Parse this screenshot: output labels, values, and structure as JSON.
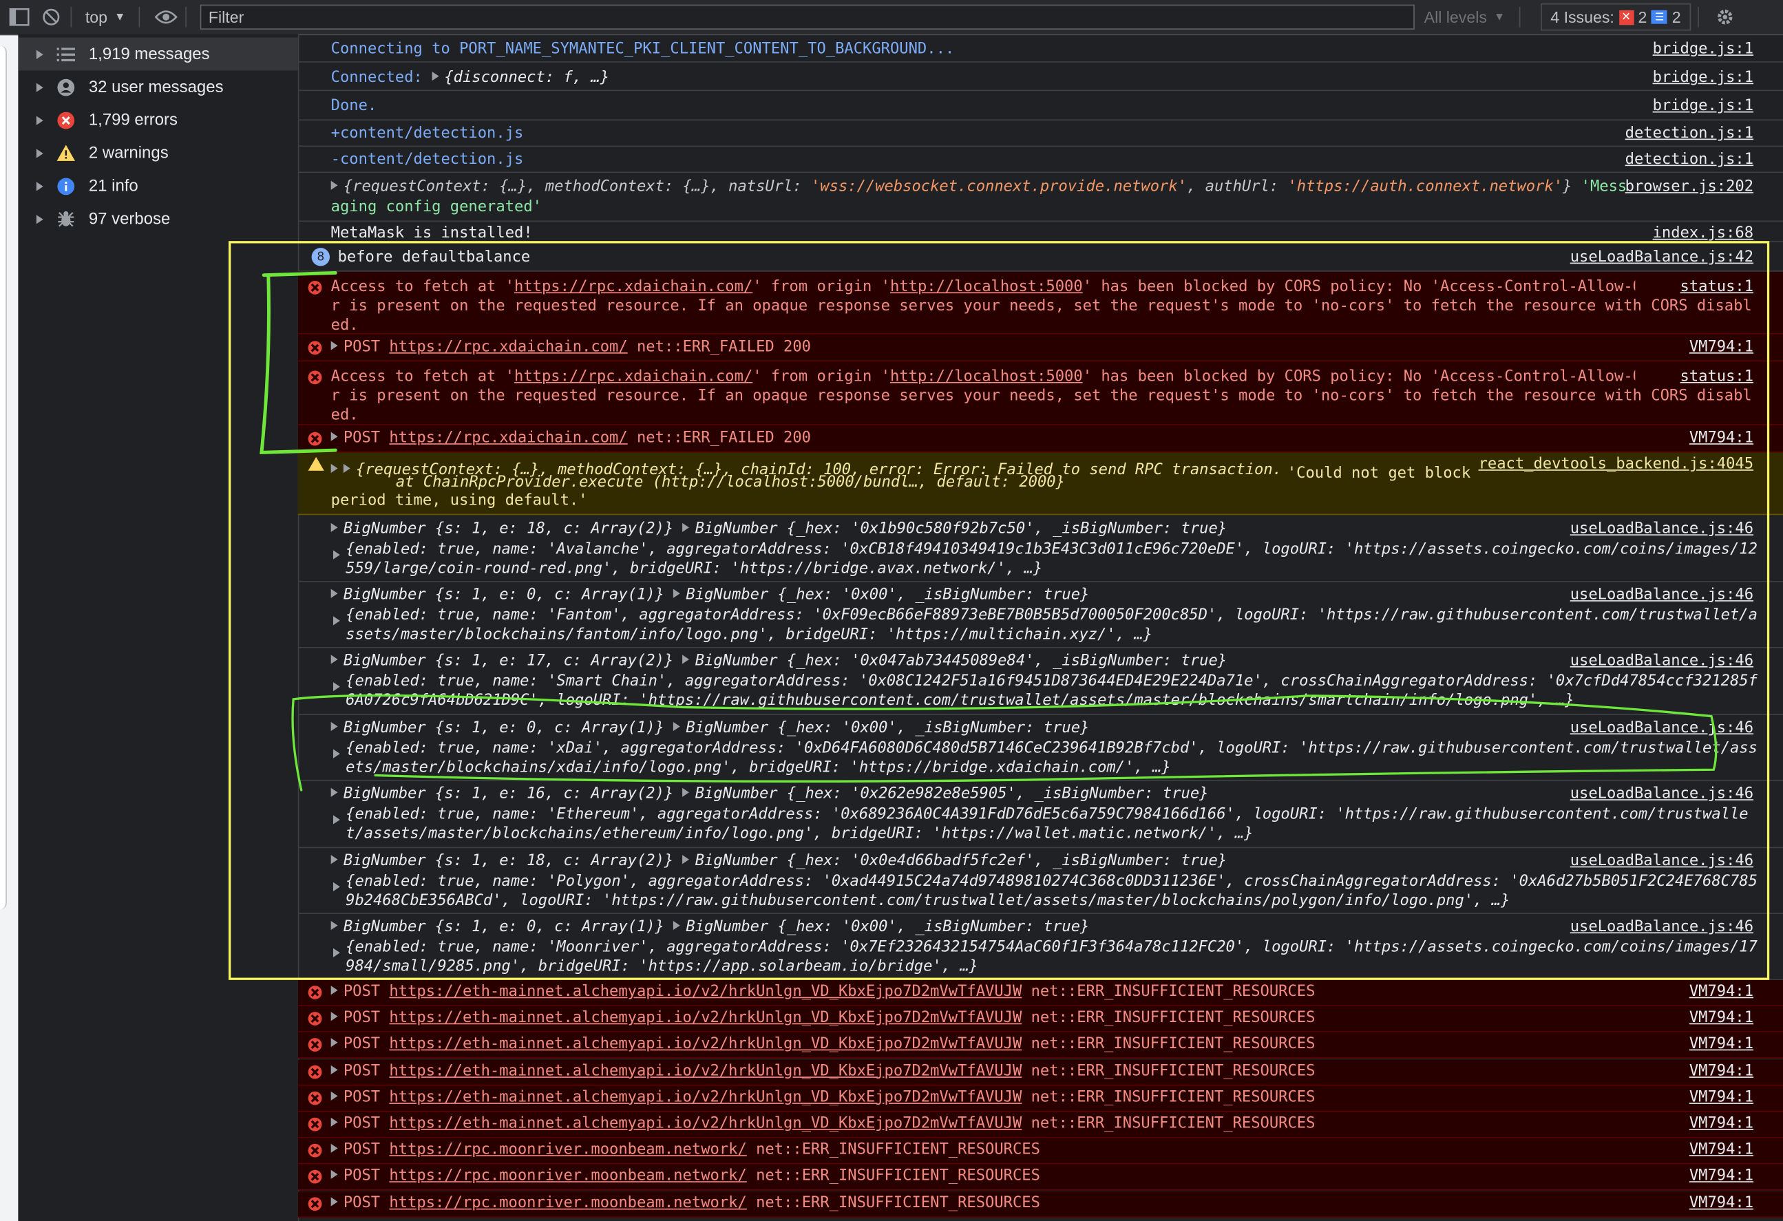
{
  "toolbar": {
    "context": "top",
    "filter_placeholder": "Filter",
    "levels": "All levels",
    "issues_label": "4 Issues:",
    "issues_errors": "2",
    "issues_info": "2"
  },
  "sidebar": {
    "items": [
      {
        "label": "1,919 messages",
        "icon": "list-icon"
      },
      {
        "label": "32 user messages",
        "icon": "user-icon"
      },
      {
        "label": "1,799 errors",
        "icon": "error-icon"
      },
      {
        "label": "2 warnings",
        "icon": "warning-icon"
      },
      {
        "label": "21 info",
        "icon": "info-icon"
      },
      {
        "label": "97 verbose",
        "icon": "bug-icon"
      }
    ]
  },
  "console": {
    "r1": {
      "text": "Connecting to PORT_NAME_SYMANTEC_PKI_CLIENT_CONTENT_TO_BACKGROUND...",
      "src": "bridge.js:1"
    },
    "r2": {
      "text": "Connected:",
      "obj": "{disconnect: f, …}",
      "src": "bridge.js:1"
    },
    "r3": {
      "text": "Done.",
      "src": "bridge.js:1"
    },
    "r4": {
      "text": "+content/detection.js",
      "src": "detection.js:1"
    },
    "r5": {
      "text": "-content/detection.js",
      "src": "detection.js:1"
    },
    "r6": {
      "a": "{requestContext: {…}, methodContext: {…}, natsUrl: ",
      "b": "'wss://websocket.connext.provide.network'",
      "c": ", authUrl: ",
      "d": "'https://auth.connext.network'",
      "e": "} ",
      "f": "'Mess",
      "g": "aging config generated'",
      "src": "browser.js:202"
    },
    "r7": {
      "text": "MetaMask is installed!",
      "src": "index.js:68"
    },
    "r8": {
      "count": "8",
      "text": "before defaultbalance",
      "src": "useLoadBalance.js:42"
    },
    "e1": {
      "a": "Access to fetch at '",
      "url": "https://rpc.xdaichain.com/",
      "b": "' from origin '",
      "origin": "http://localhost:5000",
      "c": "' has been blocked by CORS policy: No 'Access-Control-Allow-Origin' header is present on the requested resource. If an opaque response serves your needs, set the request's mode to 'no-cors' to fetch the resource with CORS disabled.",
      "src": "status:1"
    },
    "e2": {
      "method": "POST",
      "url": "https://rpc.xdaichain.com/",
      "status": "net::ERR_FAILED 200",
      "src": "VM794:1"
    },
    "e3": {
      "a": "Access to fetch at '",
      "url": "https://rpc.xdaichain.com/",
      "b": "' from origin '",
      "origin": "http://localhost:5000",
      "c": "' has been blocked by CORS policy: No 'Access-Control-Allow-Origin' header is present on the requested resource. If an opaque response serves your needs, set the request's mode to 'no-cors' to fetch the resource with CORS disabled.",
      "src": "status:1"
    },
    "e4": {
      "method": "POST",
      "url": "https://rpc.xdaichain.com/",
      "status": "net::ERR_FAILED 200",
      "src": "VM794:1"
    },
    "w1": {
      "line1": "{requestContext: {…}, methodContext: {…}, chainId: 100, error: Error: Failed to send RPC transaction.",
      "line2": "at ChainRpcProvider.execute (http://localhost:5000/bundl…, default: 2000}",
      "msg1": "'Could not get block",
      "msg2": "period time, using default.'",
      "src": "react_devtools_backend.js:4045"
    },
    "bn": [
      {
        "l1a": "BigNumber {s: 1, e: 18, c: Array(2)}",
        "l1b": "BigNumber {_hex: '0x1b90c580f92b7c50', _isBigNumber: true}",
        "l2": "{enabled: true, name: 'Avalanche', aggregatorAddress: '0xCB18f49410349419c1b3E43C3d011cE96c720eDE', logoURI: 'https://assets.coingecko.com/coins/images/12559/large/coin-round-red.png', bridgeURI: 'https://bridge.avax.network/', …}",
        "src": "useLoadBalance.js:46"
      },
      {
        "l1a": "BigNumber {s: 1, e: 0, c: Array(1)}",
        "l1b": "BigNumber {_hex: '0x00', _isBigNumber: true}",
        "l2": "{enabled: true, name: 'Fantom', aggregatorAddress: '0xF09ecB66eF88973eBE7B0B5B5d700050F200c85D', logoURI: 'https://raw.githubusercontent.com/trustwallet/assets/master/blockchains/fantom/info/logo.png', bridgeURI: 'https://multichain.xyz/', …}",
        "src": "useLoadBalance.js:46"
      },
      {
        "l1a": "BigNumber {s: 1, e: 17, c: Array(2)}",
        "l1b": "BigNumber {_hex: '0x047ab73445089e84', _isBigNumber: true}",
        "l2": "{enabled: true, name: 'Smart Chain', aggregatorAddress: '0x08C1242F51a16f9451D873644ED4E29E224Da71e', crossChainAggregatorAddress: '0x7cfDd47854ccf321285f6A0726c9fA64bD621D9C', logoURI: 'https://raw.githubusercontent.com/trustwallet/assets/master/blockchains/smartchain/info/logo.png', …}",
        "src": "useLoadBalance.js:46"
      },
      {
        "l1a": "BigNumber {s: 1, e: 0, c: Array(1)}",
        "l1b": "BigNumber {_hex: '0x00', _isBigNumber: true}",
        "l2": "{enabled: true, name: 'xDai', aggregatorAddress: '0xD64FA6080D6C480d5B7146CeC239641B92Bf7cbd', logoURI: 'https://raw.githubusercontent.com/trustwallet/assets/master/blockchains/xdai/info/logo.png', bridgeURI: 'https://bridge.xdaichain.com/', …}",
        "src": "useLoadBalance.js:46"
      },
      {
        "l1a": "BigNumber {s: 1, e: 16, c: Array(2)}",
        "l1b": "BigNumber {_hex: '0x262e982e8e5905', _isBigNumber: true}",
        "l2": "{enabled: true, name: 'Ethereum', aggregatorAddress: '0x689236A0C4A391FdD76dE5c6a759C7984166d166', logoURI: 'https://raw.githubusercontent.com/trustwallet/assets/master/blockchains/ethereum/info/logo.png', bridgeURI: 'https://wallet.matic.network/', …}",
        "src": "useLoadBalance.js:46"
      },
      {
        "l1a": "BigNumber {s: 1, e: 18, c: Array(2)}",
        "l1b": "BigNumber {_hex: '0x0e4d66badf5fc2ef', _isBigNumber: true}",
        "l2": "{enabled: true, name: 'Polygon', aggregatorAddress: '0xad44915C24a74d97489810274C368c0DD311236E', crossChainAggregatorAddress: '0xA6d27b5B051F2C24E768C7859b2468CbE356ABCd', logoURI: 'https://raw.githubusercontent.com/trustwallet/assets/master/blockchains/polygon/info/logo.png', …}",
        "src": "useLoadBalance.js:46"
      },
      {
        "l1a": "BigNumber {s: 1, e: 0, c: Array(1)}",
        "l1b": "BigNumber {_hex: '0x00', _isBigNumber: true}",
        "l2": "{enabled: true, name: 'Moonriver', aggregatorAddress: '0x7Ef2326432154754AaC60f1F3f364a78c112FC20', logoURI: 'https://assets.coingecko.com/coins/images/17984/small/9285.png', bridgeURI: 'https://app.solarbeam.io/bridge', …}",
        "src": "useLoadBalance.js:46"
      }
    ],
    "posts": [
      {
        "method": "POST",
        "url": "https://eth-mainnet.alchemyapi.io/v2/hrkUnlgn_VD_KbxEjpo7D2mVwTfAVUJW",
        "status": "net::ERR_INSUFFICIENT_RESOURCES",
        "src": "VM794:1"
      },
      {
        "method": "POST",
        "url": "https://eth-mainnet.alchemyapi.io/v2/hrkUnlgn_VD_KbxEjpo7D2mVwTfAVUJW",
        "status": "net::ERR_INSUFFICIENT_RESOURCES",
        "src": "VM794:1"
      },
      {
        "method": "POST",
        "url": "https://eth-mainnet.alchemyapi.io/v2/hrkUnlgn_VD_KbxEjpo7D2mVwTfAVUJW",
        "status": "net::ERR_INSUFFICIENT_RESOURCES",
        "src": "VM794:1"
      },
      {
        "method": "POST",
        "url": "https://eth-mainnet.alchemyapi.io/v2/hrkUnlgn_VD_KbxEjpo7D2mVwTfAVUJW",
        "status": "net::ERR_INSUFFICIENT_RESOURCES",
        "src": "VM794:1"
      },
      {
        "method": "POST",
        "url": "https://eth-mainnet.alchemyapi.io/v2/hrkUnlgn_VD_KbxEjpo7D2mVwTfAVUJW",
        "status": "net::ERR_INSUFFICIENT_RESOURCES",
        "src": "VM794:1"
      },
      {
        "method": "POST",
        "url": "https://eth-mainnet.alchemyapi.io/v2/hrkUnlgn_VD_KbxEjpo7D2mVwTfAVUJW",
        "status": "net::ERR_INSUFFICIENT_RESOURCES",
        "src": "VM794:1"
      },
      {
        "method": "POST",
        "url": "https://rpc.moonriver.moonbeam.network/",
        "status": "net::ERR_INSUFFICIENT_RESOURCES",
        "src": "VM794:1"
      },
      {
        "method": "POST",
        "url": "https://rpc.moonriver.moonbeam.network/",
        "status": "net::ERR_INSUFFICIENT_RESOURCES",
        "src": "VM794:1"
      },
      {
        "method": "POST",
        "url": "https://rpc.moonriver.moonbeam.network/",
        "status": "net::ERR_INSUFFICIENT_RESOURCES",
        "src": "VM794:1"
      }
    ]
  },
  "colors": {
    "error_bg": "#290000",
    "warn_bg": "#332b00",
    "highlight_box": "#f7f560",
    "annotation_green": "#6ee63a"
  }
}
